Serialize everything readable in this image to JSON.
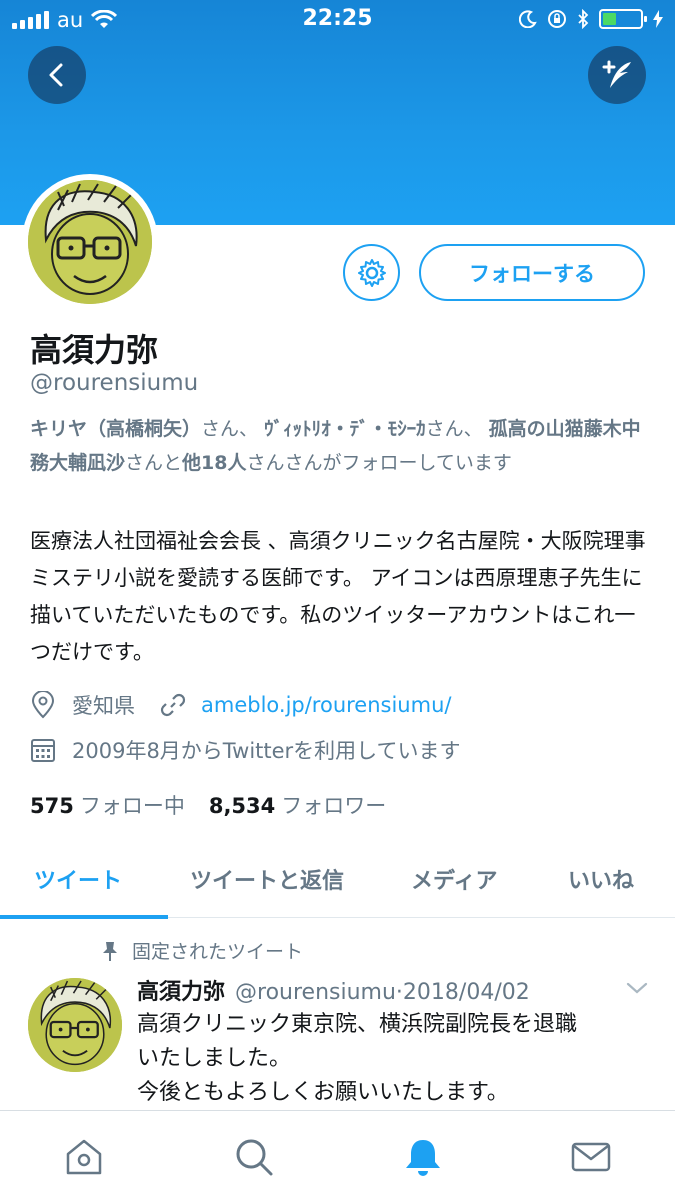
{
  "status_bar": {
    "carrier": "au",
    "time": "22:25"
  },
  "profile": {
    "name": "高須力弥",
    "handle": "@rourensiumu",
    "follow_label": "フォローする",
    "followed_by": {
      "user1": "キリヤ（高橋桐矢）",
      "sep1": "さん、",
      "user2": "ｳﾞｨｯﾄﾘｵ・ﾃﾞ・ﾓｼｰｶ",
      "sep2": "さん、",
      "user3": "孤高の山猫藤木中務大輔凪沙",
      "sep3": "さんと",
      "others": "他18人",
      "suffix": "さんさんがフォローしています"
    },
    "bio": "医療法人社団福祉会会長 、高須クリニック名古屋院・大阪院理事 ミステリ小説を愛読する医師です。 アイコンは西原理恵子先生に描いていただいたものです。私のツイッターアカウントはこれ一つだけです。",
    "location": "愛知県",
    "website": "ameblo.jp/rourensiumu/",
    "joined": "2009年8月からTwitterを利用しています",
    "following_count": "575",
    "following_label": "フォロー中",
    "followers_count": "8,534",
    "followers_label": "フォロワー"
  },
  "tabs": [
    {
      "label": "ツイート",
      "active": true
    },
    {
      "label": "ツイートと返信",
      "active": false
    },
    {
      "label": "メディア",
      "active": false
    },
    {
      "label": "いいね",
      "active": false
    }
  ],
  "pinned_tweet": {
    "pinned_label": "固定されたツイート",
    "name": "高須力弥",
    "handle": "@rourensiumu",
    "dot": "·",
    "date": "2018/04/02",
    "lines": [
      "高須クリニック東京院、横浜院副院長を退職",
      "いたしました。",
      "今後ともよろしくお願いいたします。"
    ]
  },
  "bottom_nav": [
    "home-icon",
    "search-icon",
    "notifications-icon",
    "messages-icon"
  ],
  "colors": {
    "accent": "#1da1f2",
    "secondary_text": "#657786",
    "primary_text": "#14171a"
  }
}
